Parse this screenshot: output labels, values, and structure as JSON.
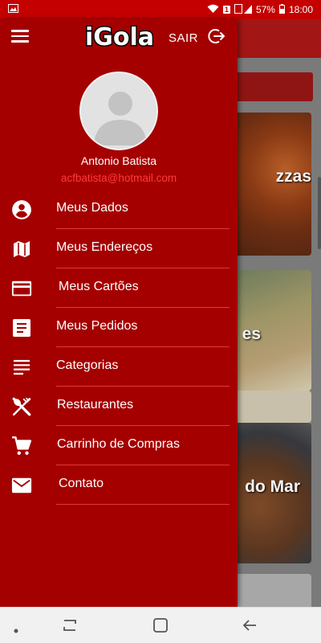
{
  "status_bar": {
    "battery": "57%",
    "time": "18:00",
    "sim_badge": "1"
  },
  "app": {
    "logo_text": "iGola",
    "logout_label": "SAIR",
    "brand_color": "#a50000",
    "accent_color": "#ff3a3a"
  },
  "user": {
    "name": "Antonio Batista",
    "email": "acfbatista@hotmail.com"
  },
  "menu": [
    {
      "label": "Meus Dados",
      "icon": "account-circle-icon"
    },
    {
      "label": "Meus Endereços",
      "icon": "map-icon"
    },
    {
      "label": "Meus Cartões",
      "icon": "credit-card-icon"
    },
    {
      "label": "Meus Pedidos",
      "icon": "receipt-icon"
    },
    {
      "label": "Categorias",
      "icon": "list-icon"
    },
    {
      "label": "Restaurantes",
      "icon": "restaurant-icon"
    },
    {
      "label": "Carrinho de Compras",
      "icon": "shopping-cart-icon"
    },
    {
      "label": "Contato",
      "icon": "email-icon"
    }
  ],
  "background": {
    "cards": [
      "zzas",
      "es",
      "do Mar"
    ]
  }
}
